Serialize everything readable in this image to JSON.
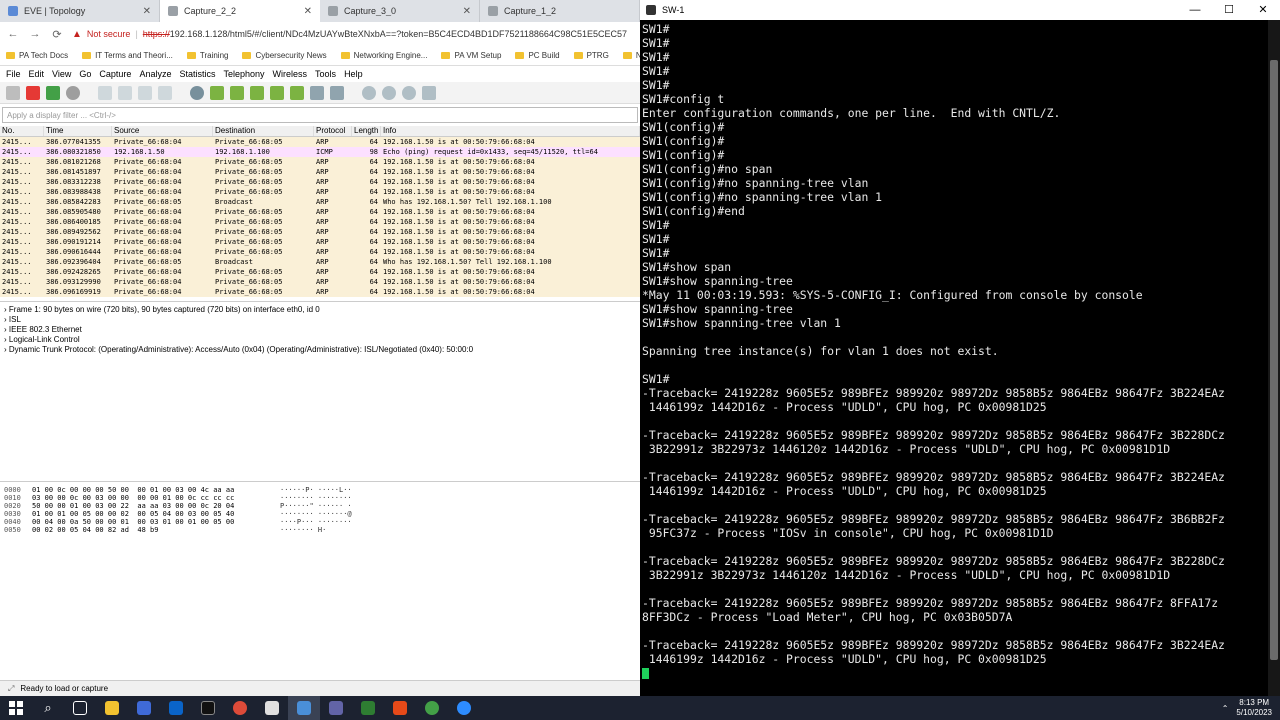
{
  "browser": {
    "tabs": [
      {
        "title": "EVE | Topology",
        "active": false
      },
      {
        "title": "Capture_2_2",
        "active": true
      },
      {
        "title": "Capture_3_0",
        "active": false
      },
      {
        "title": "Capture_1_2",
        "active": false
      }
    ],
    "security": "Not secure",
    "url_proto": "https://",
    "url_rest": "192.168.1.128/html5/#/client/NDc4MzUAYwBteXNxbA==?token=B5C4ECD4BD1DF7521188664C98C51E5CEC57",
    "bookmarks": [
      "PA Tech Docs",
      "IT Terms and Theori...",
      "Training",
      "Cybersecurity News",
      "Networking Engine...",
      "PA VM Setup",
      "PC Build",
      "PTRG",
      "Ne"
    ]
  },
  "wireshark": {
    "menu": [
      "File",
      "Edit",
      "View",
      "Go",
      "Capture",
      "Analyze",
      "Statistics",
      "Telephony",
      "Wireless",
      "Tools",
      "Help"
    ],
    "filter_placeholder": "Apply a display filter ... <Ctrl-/>",
    "columns": [
      "No.",
      "Time",
      "Source",
      "Destination",
      "Protocol",
      "Length",
      "Info"
    ],
    "packets": [
      {
        "no": "2415...",
        "time": "386.077041355",
        "src": "Private_66:68:04",
        "dst": "Private_66:68:05",
        "proto": "ARP",
        "len": "64",
        "info": "192.168.1.50 is at 00:50:79:66:68:04",
        "kind": "arp"
      },
      {
        "no": "2415...",
        "time": "386.080321850",
        "src": "192.168.1.50",
        "dst": "192.168.1.100",
        "proto": "ICMP",
        "len": "98",
        "info": "Echo (ping) request  id=0x1433, seq=45/11520, ttl=64",
        "kind": "icmp"
      },
      {
        "no": "2415...",
        "time": "386.081021268",
        "src": "Private_66:68:04",
        "dst": "Private_66:68:05",
        "proto": "ARP",
        "len": "64",
        "info": "192.168.1.50 is at 00:50:79:66:68:04",
        "kind": "arp"
      },
      {
        "no": "2415...",
        "time": "386.081451897",
        "src": "Private_66:68:04",
        "dst": "Private_66:68:05",
        "proto": "ARP",
        "len": "64",
        "info": "192.168.1.50 is at 00:50:79:66:68:04",
        "kind": "arp"
      },
      {
        "no": "2415...",
        "time": "386.083312238",
        "src": "Private_66:68:04",
        "dst": "Private_66:68:05",
        "proto": "ARP",
        "len": "64",
        "info": "192.168.1.50 is at 00:50:79:66:68:04",
        "kind": "arp"
      },
      {
        "no": "2415...",
        "time": "386.083988438",
        "src": "Private_66:68:04",
        "dst": "Private_66:68:05",
        "proto": "ARP",
        "len": "64",
        "info": "192.168.1.50 is at 00:50:79:66:68:04",
        "kind": "arp"
      },
      {
        "no": "2415...",
        "time": "386.085842283",
        "src": "Private_66:68:05",
        "dst": "Broadcast",
        "proto": "ARP",
        "len": "64",
        "info": "Who has 192.168.1.50? Tell 192.168.1.100",
        "kind": "arp"
      },
      {
        "no": "2415...",
        "time": "386.085905480",
        "src": "Private_66:68:04",
        "dst": "Private_66:68:05",
        "proto": "ARP",
        "len": "64",
        "info": "192.168.1.50 is at 00:50:79:66:68:04",
        "kind": "arp"
      },
      {
        "no": "2415...",
        "time": "386.086400185",
        "src": "Private_66:68:04",
        "dst": "Private_66:68:05",
        "proto": "ARP",
        "len": "64",
        "info": "192.168.1.50 is at 00:50:79:66:68:04",
        "kind": "arp"
      },
      {
        "no": "2415...",
        "time": "386.089492562",
        "src": "Private_66:68:04",
        "dst": "Private_66:68:05",
        "proto": "ARP",
        "len": "64",
        "info": "192.168.1.50 is at 00:50:79:66:68:04",
        "kind": "arp"
      },
      {
        "no": "2415...",
        "time": "386.090191214",
        "src": "Private_66:68:04",
        "dst": "Private_66:68:05",
        "proto": "ARP",
        "len": "64",
        "info": "192.168.1.50 is at 00:50:79:66:68:04",
        "kind": "arp"
      },
      {
        "no": "2415...",
        "time": "386.090616444",
        "src": "Private_66:68:04",
        "dst": "Private_66:68:05",
        "proto": "ARP",
        "len": "64",
        "info": "192.168.1.50 is at 00:50:79:66:68:04",
        "kind": "arp"
      },
      {
        "no": "2415...",
        "time": "386.092396404",
        "src": "Private_66:68:05",
        "dst": "Broadcast",
        "proto": "ARP",
        "len": "64",
        "info": "Who has 192.168.1.50? Tell 192.168.1.100",
        "kind": "arp"
      },
      {
        "no": "2415...",
        "time": "386.092428265",
        "src": "Private_66:68:04",
        "dst": "Private_66:68:05",
        "proto": "ARP",
        "len": "64",
        "info": "192.168.1.50 is at 00:50:79:66:68:04",
        "kind": "arp"
      },
      {
        "no": "2415...",
        "time": "386.093129990",
        "src": "Private_66:68:04",
        "dst": "Private_66:68:05",
        "proto": "ARP",
        "len": "64",
        "info": "192.168.1.50 is at 00:50:79:66:68:04",
        "kind": "arp"
      },
      {
        "no": "2415...",
        "time": "386.096169919",
        "src": "Private_66:68:04",
        "dst": "Private_66:68:05",
        "proto": "ARP",
        "len": "64",
        "info": "192.168.1.50 is at 00:50:79:66:68:04",
        "kind": "arp"
      }
    ],
    "details": [
      "Frame 1: 90 bytes on wire (720 bits), 90 bytes captured (720 bits) on interface eth0, id 0",
      "ISL",
      "IEEE 802.3 Ethernet",
      "Logical-Link Control",
      "Dynamic Trunk Protocol:  (Operating/Administrative): Access/Auto (0x04) (Operating/Administrative): ISL/Negotiated (0x40): 50:00:0"
    ],
    "hex": [
      {
        "off": "0000",
        "bytes": "01 00 0c 00 00 00 50 00  00 01 00 03 00 4c aa aa",
        "ascii": "······P· ·····L··"
      },
      {
        "off": "0010",
        "bytes": "03 00 00 0c 00 03 00 00  00 00 01 00 0c cc cc cc",
        "ascii": "········ ········"
      },
      {
        "off": "0020",
        "bytes": "50 00 00 01 00 03 00 22  aa aa 03 00 00 0c 20 04",
        "ascii": "P······\" ······ ·"
      },
      {
        "off": "0030",
        "bytes": "01 00 01 00 05 00 00 02  00 05 04 00 03 00 05 40",
        "ascii": "········ ·······@"
      },
      {
        "off": "0040",
        "bytes": "00 04 00 0a 50 00 00 01  00 03 01 00 01 00 05 00",
        "ascii": "····P··· ········"
      },
      {
        "off": "0050",
        "bytes": "00 02 00 05 04 00 82 ad  48 b9",
        "ascii": "········ H·"
      }
    ],
    "status": "Ready to load or capture"
  },
  "terminal": {
    "title": "SW-1",
    "lines": [
      "SW1#",
      "SW1#",
      "SW1#",
      "SW1#",
      "SW1#",
      "SW1#config t",
      "Enter configuration commands, one per line.  End with CNTL/Z.",
      "SW1(config)#",
      "SW1(config)#",
      "SW1(config)#",
      "SW1(config)#no span",
      "SW1(config)#no spanning-tree vlan",
      "SW1(config)#no spanning-tree vlan 1",
      "SW1(config)#end",
      "SW1#",
      "SW1#",
      "SW1#",
      "SW1#show span",
      "SW1#show spanning-tree",
      "*May 11 00:03:19.593: %SYS-5-CONFIG_I: Configured from console by console",
      "SW1#show spanning-tree",
      "SW1#show spanning-tree vlan 1",
      "",
      "Spanning tree instance(s) for vlan 1 does not exist.",
      "",
      "SW1#",
      "-Traceback= 2419228z 9605E5z 989BFEz 989920z 98972Dz 9858B5z 9864EBz 98647Fz 3B224EAz",
      " 1446199z 1442D16z - Process \"UDLD\", CPU hog, PC 0x00981D25",
      "",
      "-Traceback= 2419228z 9605E5z 989BFEz 989920z 98972Dz 9858B5z 9864EBz 98647Fz 3B228DCz",
      " 3B22991z 3B22973z 1446120z 1442D16z - Process \"UDLD\", CPU hog, PC 0x00981D1D",
      "",
      "-Traceback= 2419228z 9605E5z 989BFEz 989920z 98972Dz 9858B5z 9864EBz 98647Fz 3B224EAz",
      " 1446199z 1442D16z - Process \"UDLD\", CPU hog, PC 0x00981D25",
      "",
      "-Traceback= 2419228z 9605E5z 989BFEz 989920z 98972Dz 9858B5z 9864EBz 98647Fz 3B6BB2Fz",
      " 95FC37z - Process \"IOSv in console\", CPU hog, PC 0x00981D1D",
      "",
      "-Traceback= 2419228z 9605E5z 989BFEz 989920z 98972Dz 9858B5z 9864EBz 98647Fz 3B228DCz",
      " 3B22991z 3B22973z 1446120z 1442D16z - Process \"UDLD\", CPU hog, PC 0x00981D1D",
      "",
      "-Traceback= 2419228z 9605E5z 989BFEz 989920z 98972Dz 9858B5z 9864EBz 98647Fz 8FFA17z",
      "8FF3DCz - Process \"Load Meter\", CPU hog, PC 0x03B05D7A",
      "",
      "-Traceback= 2419228z 9605E5z 989BFEz 989920z 98972Dz 9858B5z 9864EBz 98647Fz 3B224EAz",
      " 1446199z 1442D16z - Process \"UDLD\", CPU hog, PC 0x00981D25"
    ]
  },
  "taskbar": {
    "time": "8:13 PM",
    "date": "5/10/2023"
  },
  "colors": {
    "arp_row": "#faf0d7",
    "icmp_row": "#fce0ff",
    "terminal_bg": "#000000",
    "cursor": "#1ed05b"
  }
}
